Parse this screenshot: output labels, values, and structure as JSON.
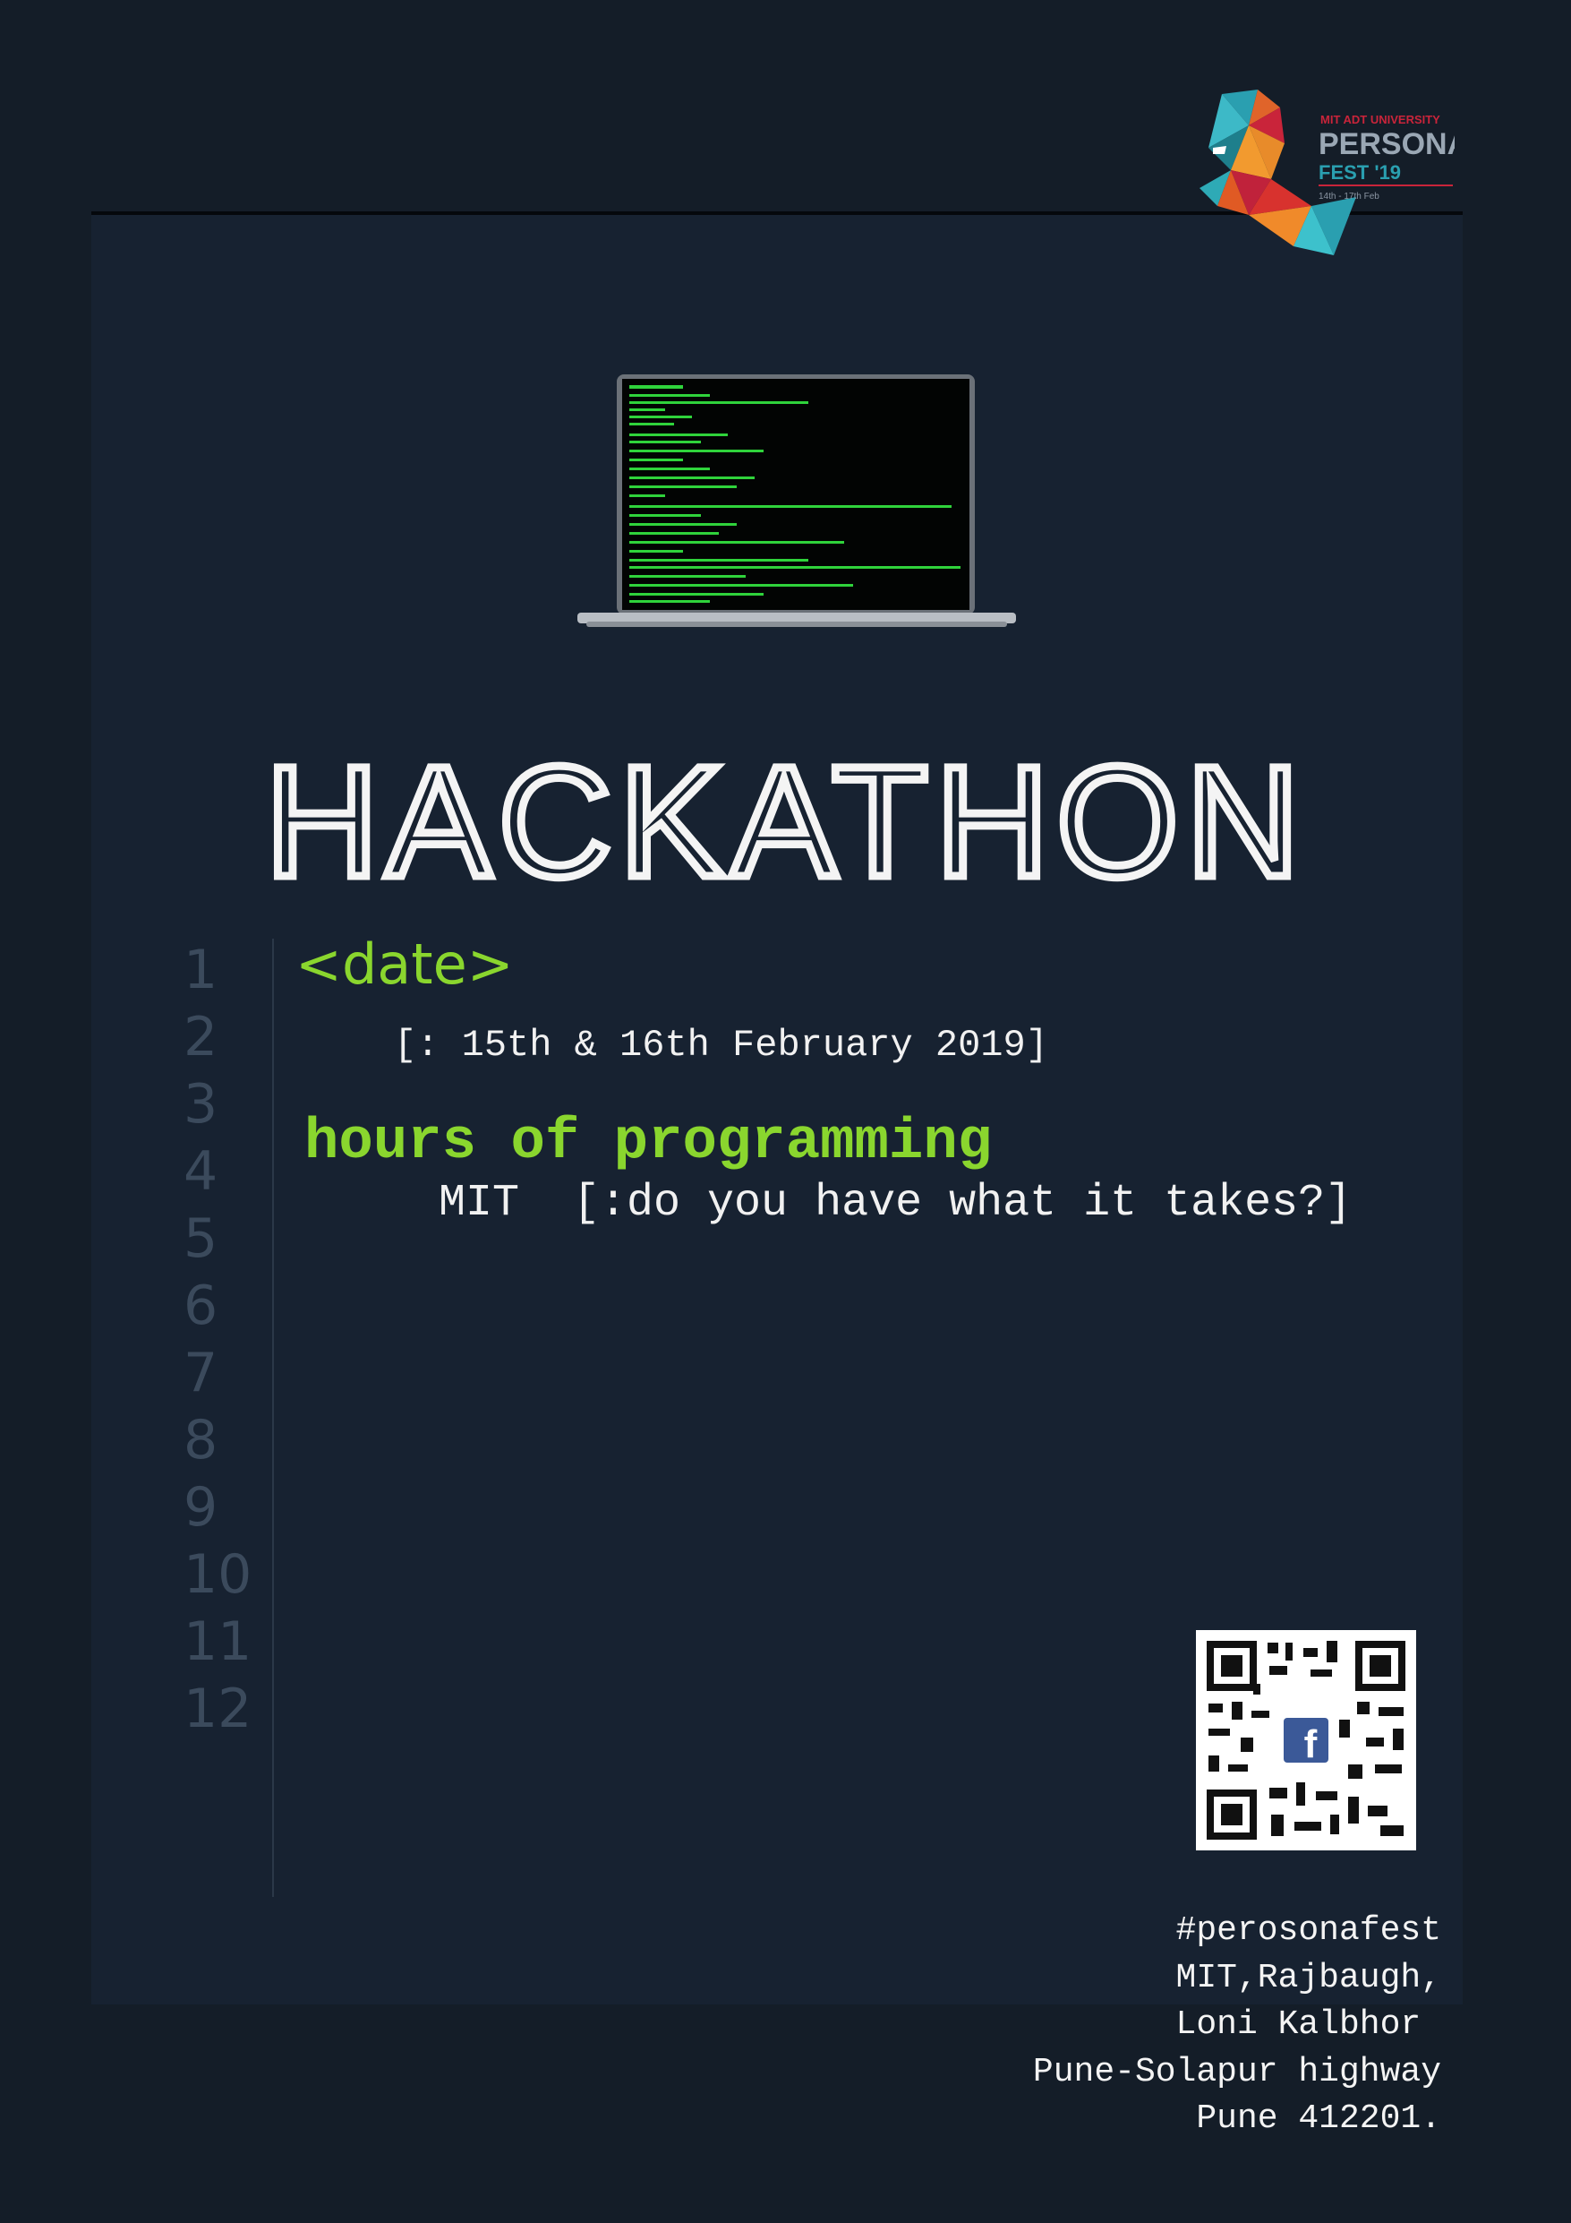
{
  "logo": {
    "university": "MIT ADT UNIVERSITY",
    "name": "PERSONA",
    "fest": "FEST '19",
    "dates": "14th - 17th Feb"
  },
  "title": "HACKATHON",
  "editor": {
    "line_numbers": [
      "1",
      "2",
      "3",
      "4",
      "5",
      "6",
      "7",
      "8",
      "9",
      "10",
      "11",
      "12"
    ],
    "date_tag": "<date>",
    "date_value": "[: 15th & 16th February 2019]",
    "hours": "hours of programming",
    "tagline": "MIT  [:do you have what it takes?]"
  },
  "address": {
    "hashtag": "#perosonafest",
    "line1": "MIT,Rajbaugh,",
    "line2": "Loni Kalbhor ",
    "line3": "Pune-Solapur highway",
    "line4": "Pune 412201."
  },
  "icons": {
    "qr": "qr-code",
    "facebook": "facebook-icon"
  },
  "colors": {
    "background": "#141d28",
    "accent_green": "#8ad62e",
    "text": "#f1f1f1"
  }
}
